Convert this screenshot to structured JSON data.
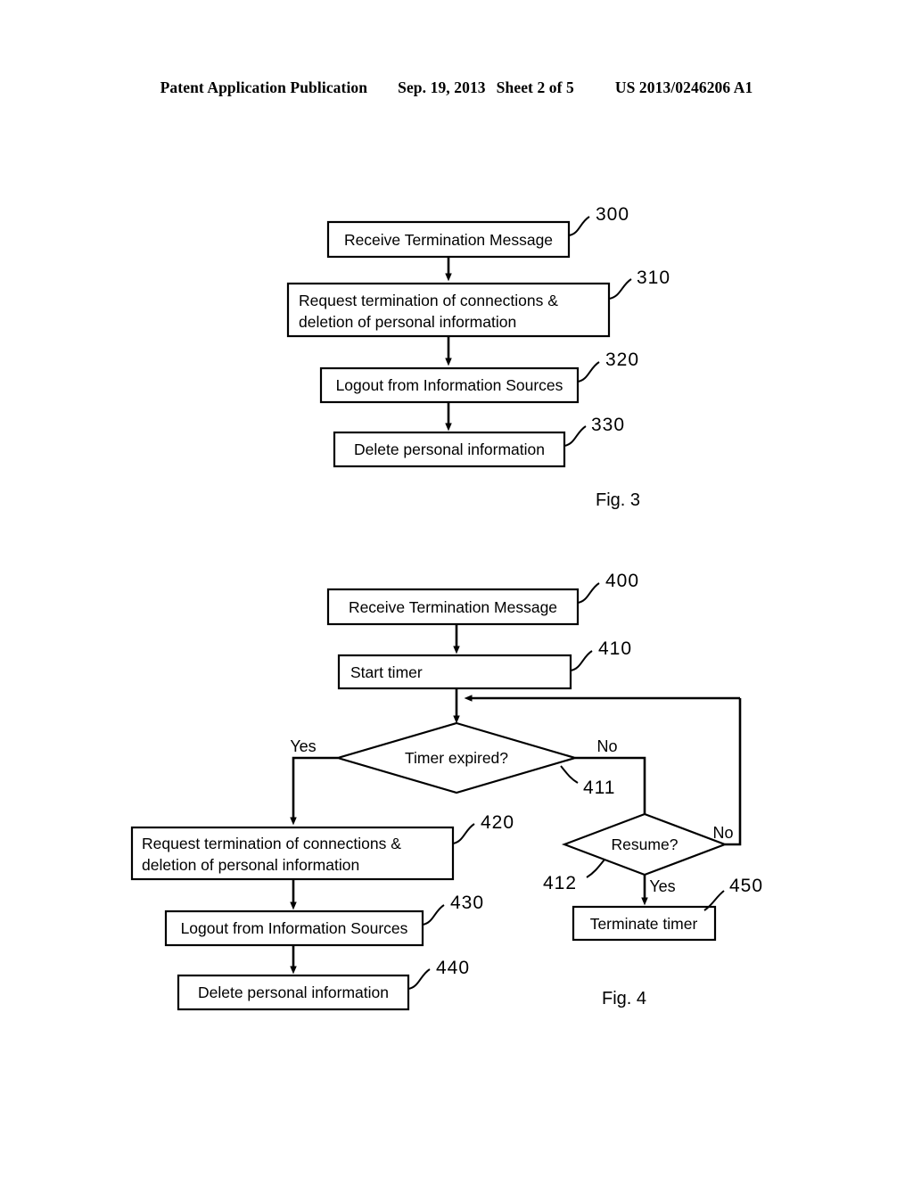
{
  "header": {
    "publication": "Patent Application Publication",
    "date": "Sep. 19, 2013",
    "sheet": "Sheet 2 of 5",
    "patent_number": "US 2013/0246206 A1"
  },
  "figures": [
    {
      "caption": "Fig. 3",
      "nodes": [
        {
          "ref": "300",
          "label": "Receive Termination Message",
          "shape": "process"
        },
        {
          "ref": "310",
          "label_line1": "Request termination of connections &",
          "label_line2": "deletion of personal information",
          "shape": "process"
        },
        {
          "ref": "320",
          "label": "Logout from Information Sources",
          "shape": "process"
        },
        {
          "ref": "330",
          "label": "Delete personal information",
          "shape": "process"
        }
      ]
    },
    {
      "caption": "Fig. 4",
      "nodes": [
        {
          "ref": "400",
          "label": "Receive Termination Message",
          "shape": "process"
        },
        {
          "ref": "410",
          "label": "Start timer",
          "shape": "process"
        },
        {
          "ref": "411",
          "label": "Timer expired?",
          "shape": "decision",
          "branch_left": "Yes",
          "branch_right": "No"
        },
        {
          "ref": "412",
          "label": "Resume?",
          "shape": "decision",
          "branch_right": "No",
          "branch_bottom": "Yes"
        },
        {
          "ref": "420",
          "label_line1": "Request termination of connections &",
          "label_line2": "deletion of personal information",
          "shape": "process"
        },
        {
          "ref": "430",
          "label": "Logout from Information Sources",
          "shape": "process"
        },
        {
          "ref": "440",
          "label": "Delete personal information",
          "shape": "process"
        },
        {
          "ref": "450",
          "label": "Terminate timer",
          "shape": "process"
        }
      ]
    }
  ],
  "colors": {
    "ink": "#000000",
    "paper": "#ffffff"
  }
}
